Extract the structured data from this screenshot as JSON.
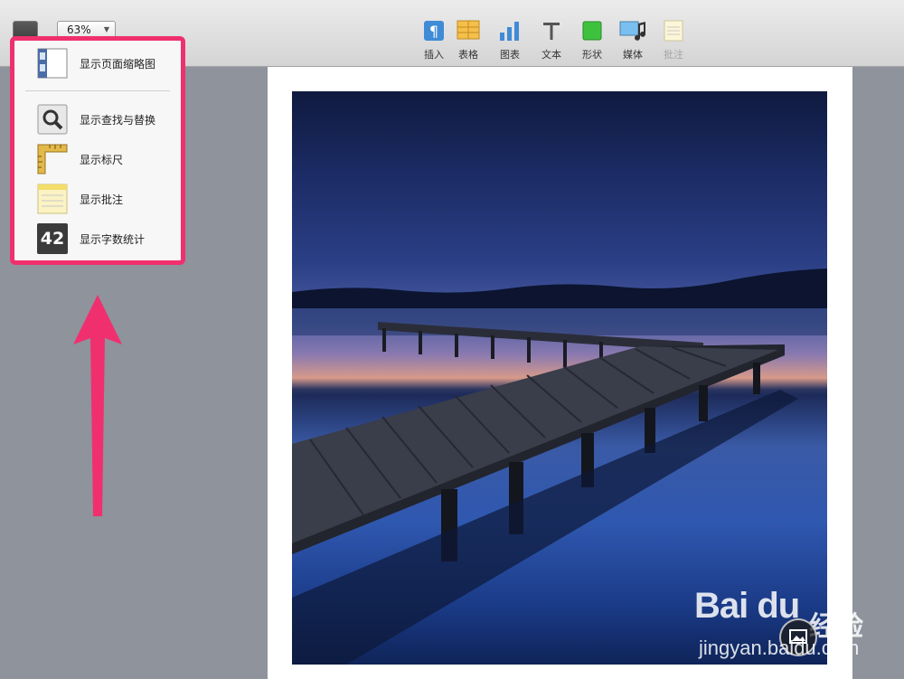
{
  "toolbar": {
    "zoom_value": "63%",
    "tools": [
      {
        "label": "插入",
        "icon": "pilcrow-icon",
        "enabled": true
      },
      {
        "label": "表格",
        "icon": "table-icon",
        "enabled": true
      },
      {
        "label": "图表",
        "icon": "chart-icon",
        "enabled": true
      },
      {
        "label": "文本",
        "icon": "text-icon",
        "enabled": true
      },
      {
        "label": "形状",
        "icon": "shape-icon",
        "enabled": true
      },
      {
        "label": "媒体",
        "icon": "media-icon",
        "enabled": true
      },
      {
        "label": "批注",
        "icon": "comment-icon",
        "enabled": false
      }
    ]
  },
  "view_menu": {
    "items": [
      {
        "label": "显示页面缩略图",
        "icon": "page-thumbnails-icon"
      },
      {
        "label": "显示查找与替换",
        "icon": "magnifier-icon"
      },
      {
        "label": "显示标尺",
        "icon": "ruler-icon"
      },
      {
        "label": "显示批注",
        "icon": "notes-icon"
      },
      {
        "label": "显示字数统计",
        "icon": "word-count-icon",
        "badge": "42"
      }
    ]
  },
  "colors": {
    "highlight": "#f0306e",
    "annotation_arrow": "#f0306e",
    "workspace": "#8e939c"
  },
  "watermark": {
    "logo": "Bai du",
    "logo_suffix": "经验",
    "url": "jingyan.baidu.com"
  }
}
